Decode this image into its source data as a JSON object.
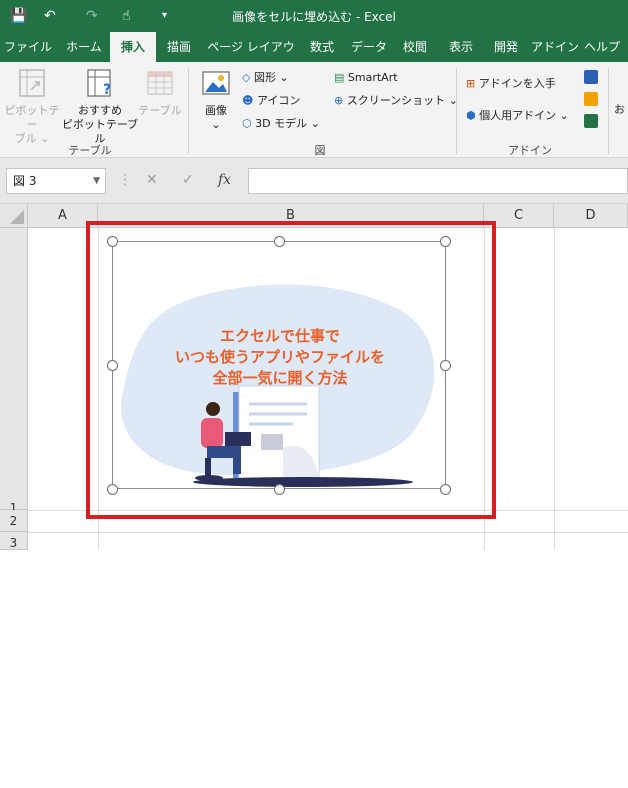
{
  "titlebar": {
    "title": "画像をセルに埋め込む  -  Excel",
    "save_icon": "💾",
    "undo_icon": "↶",
    "redo_icon": "↷",
    "touch_icon": "☝",
    "customize_icon": "▾",
    "bg_color": "#217346"
  },
  "tabs": [
    {
      "label": "ファイル",
      "active": false
    },
    {
      "label": "ホーム",
      "active": false
    },
    {
      "label": "挿入",
      "active": true
    },
    {
      "label": "描画",
      "active": false
    },
    {
      "label": "ページ レイアウト",
      "active": false
    },
    {
      "label": "数式",
      "active": false
    },
    {
      "label": "データ",
      "active": false
    },
    {
      "label": "校閲",
      "active": false
    },
    {
      "label": "表示",
      "active": false
    },
    {
      "label": "開発",
      "active": false
    },
    {
      "label": "アドイン",
      "active": false
    },
    {
      "label": "ヘルプ",
      "active": false
    }
  ],
  "ribbon": {
    "tables_group": {
      "name": "テーブル",
      "pivot_line1": "ピボットテー",
      "pivot_line2": "ブル ⌄",
      "recommended_line1": "おすすめ",
      "recommended_line2": "ピボットテーブル",
      "table": "テーブル"
    },
    "illustrations_group": {
      "name": "図",
      "image": "画像",
      "image_arrow": "⌄",
      "shapes": "図形 ⌄",
      "icons": "アイコン",
      "model3d": "3D モデル  ⌄",
      "smartart": "SmartArt",
      "screenshot": "スクリーンショット  ⌄"
    },
    "addins_group": {
      "name": "アドイン",
      "get_addins": "アドインを入手",
      "my_addins": "個人用アドイン  ⌄",
      "overflow": "お"
    }
  },
  "formula_bar": {
    "name_box": "図 3",
    "cancel": "✕",
    "enter": "✓",
    "fx": "fx",
    "value": ""
  },
  "grid": {
    "columns": [
      "A",
      "B",
      "C",
      "D"
    ],
    "rows": [
      "1",
      "2",
      "3"
    ]
  },
  "picture": {
    "line1": "エクセルで仕事で",
    "line2": "いつも使うアプリやファイルを",
    "line3": "全部一気に開く方法",
    "accent_color": "#e8602a",
    "blob_color": "#dfe8f7"
  },
  "highlight_color": "#d42020"
}
